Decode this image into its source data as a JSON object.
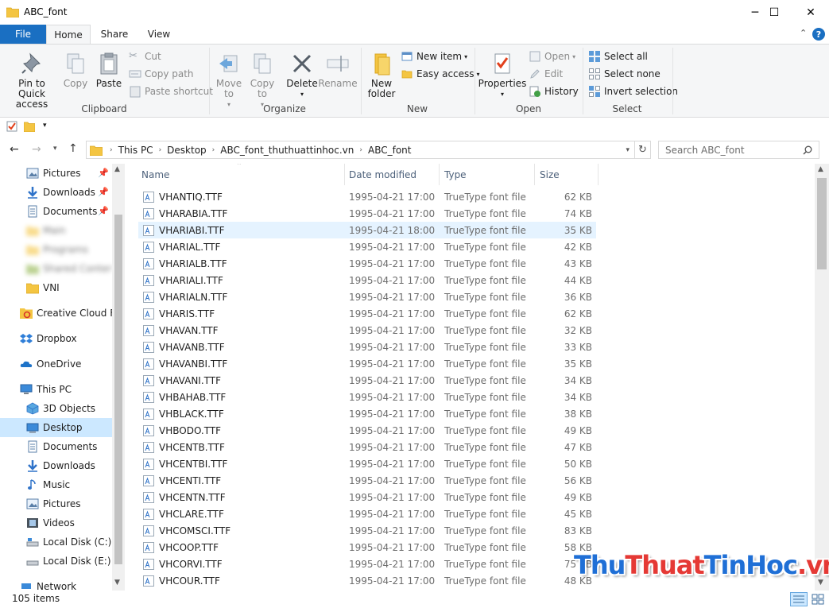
{
  "window": {
    "title": "ABC_font",
    "minimize_glyph": "─",
    "maximize_glyph": "☐",
    "close_glyph": "✕"
  },
  "ribbon_tabs": {
    "file": "File",
    "home": "Home",
    "share": "Share",
    "view": "View",
    "collapse_glyph": "⌃",
    "help_glyph": "?"
  },
  "ribbon": {
    "clipboard": {
      "label": "Clipboard",
      "pin": "Pin to Quick access",
      "copy": "Copy",
      "paste": "Paste",
      "cut": "Cut",
      "copy_path": "Copy path",
      "paste_shortcut": "Paste shortcut"
    },
    "organize": {
      "label": "Organize",
      "move_to": "Move to",
      "copy_to": "Copy to",
      "delete": "Delete",
      "rename": "Rename"
    },
    "new": {
      "label": "New",
      "new_folder": "New folder",
      "new_item": "New item",
      "easy_access": "Easy access"
    },
    "open": {
      "label": "Open",
      "properties": "Properties",
      "open": "Open",
      "edit": "Edit",
      "history": "History"
    },
    "select": {
      "label": "Select",
      "select_all": "Select all",
      "select_none": "Select none",
      "invert_selection": "Invert selection"
    }
  },
  "address": {
    "breadcrumbs": [
      "This PC",
      "Desktop",
      "ABC_font_thuthuattinhoc.vn",
      "ABC_font"
    ],
    "search_placeholder": "Search ABC_font"
  },
  "nav_pane": {
    "quick_access": [
      {
        "label": "Pictures",
        "icon": "pictures-icon",
        "pinned": true
      },
      {
        "label": "Downloads",
        "icon": "downloads-icon",
        "pinned": true
      },
      {
        "label": "Documents",
        "icon": "documents-icon",
        "pinned": true
      }
    ],
    "blurred_items": [
      "Main",
      "Programs",
      "Shared Content"
    ],
    "vni": "VNI",
    "creative_cloud": "Creative Cloud Fil",
    "dropbox": "Dropbox",
    "onedrive": "OneDrive",
    "this_pc": "This PC",
    "this_pc_items": [
      {
        "label": "3D Objects",
        "icon": "3d-objects-icon",
        "selected": false
      },
      {
        "label": "Desktop",
        "icon": "desktop-icon",
        "selected": true
      },
      {
        "label": "Documents",
        "icon": "documents-icon",
        "selected": false
      },
      {
        "label": "Downloads",
        "icon": "downloads-icon",
        "selected": false
      },
      {
        "label": "Music",
        "icon": "music-icon",
        "selected": false
      },
      {
        "label": "Pictures",
        "icon": "pictures-icon",
        "selected": false
      },
      {
        "label": "Videos",
        "icon": "videos-icon",
        "selected": false
      },
      {
        "label": "Local Disk (C:)",
        "icon": "drive-icon",
        "selected": false
      },
      {
        "label": "Local Disk (E:)",
        "icon": "drive-icon",
        "selected": false
      }
    ],
    "network": "Network"
  },
  "file_list": {
    "columns": {
      "name": "Name",
      "date": "Date modified",
      "type": "Type",
      "size": "Size"
    },
    "hovered_row": 2,
    "rows": [
      {
        "name": "VHANTIQ.TTF",
        "date": "1995-04-21 17:00",
        "type": "TrueType font file",
        "size": "62 KB"
      },
      {
        "name": "VHARABIA.TTF",
        "date": "1995-04-21 17:00",
        "type": "TrueType font file",
        "size": "74 KB"
      },
      {
        "name": "VHARIABI.TTF",
        "date": "1995-04-21 18:00",
        "type": "TrueType font file",
        "size": "35 KB"
      },
      {
        "name": "VHARIAL.TTF",
        "date": "1995-04-21 17:00",
        "type": "TrueType font file",
        "size": "42 KB"
      },
      {
        "name": "VHARIALB.TTF",
        "date": "1995-04-21 17:00",
        "type": "TrueType font file",
        "size": "43 KB"
      },
      {
        "name": "VHARIALI.TTF",
        "date": "1995-04-21 17:00",
        "type": "TrueType font file",
        "size": "44 KB"
      },
      {
        "name": "VHARIALN.TTF",
        "date": "1995-04-21 17:00",
        "type": "TrueType font file",
        "size": "36 KB"
      },
      {
        "name": "VHARIS.TTF",
        "date": "1995-04-21 17:00",
        "type": "TrueType font file",
        "size": "62 KB"
      },
      {
        "name": "VHAVAN.TTF",
        "date": "1995-04-21 17:00",
        "type": "TrueType font file",
        "size": "32 KB"
      },
      {
        "name": "VHAVANB.TTF",
        "date": "1995-04-21 17:00",
        "type": "TrueType font file",
        "size": "33 KB"
      },
      {
        "name": "VHAVANBI.TTF",
        "date": "1995-04-21 17:00",
        "type": "TrueType font file",
        "size": "35 KB"
      },
      {
        "name": "VHAVANI.TTF",
        "date": "1995-04-21 17:00",
        "type": "TrueType font file",
        "size": "34 KB"
      },
      {
        "name": "VHBAHAB.TTF",
        "date": "1995-04-21 17:00",
        "type": "TrueType font file",
        "size": "34 KB"
      },
      {
        "name": "VHBLACK.TTF",
        "date": "1995-04-21 17:00",
        "type": "TrueType font file",
        "size": "38 KB"
      },
      {
        "name": "VHBODO.TTF",
        "date": "1995-04-21 17:00",
        "type": "TrueType font file",
        "size": "49 KB"
      },
      {
        "name": "VHCENTB.TTF",
        "date": "1995-04-21 17:00",
        "type": "TrueType font file",
        "size": "47 KB"
      },
      {
        "name": "VHCENTBI.TTF",
        "date": "1995-04-21 17:00",
        "type": "TrueType font file",
        "size": "50 KB"
      },
      {
        "name": "VHCENTI.TTF",
        "date": "1995-04-21 17:00",
        "type": "TrueType font file",
        "size": "56 KB"
      },
      {
        "name": "VHCENTN.TTF",
        "date": "1995-04-21 17:00",
        "type": "TrueType font file",
        "size": "49 KB"
      },
      {
        "name": "VHCLARE.TTF",
        "date": "1995-04-21 17:00",
        "type": "TrueType font file",
        "size": "45 KB"
      },
      {
        "name": "VHCOMSCI.TTF",
        "date": "1995-04-21 17:00",
        "type": "TrueType font file",
        "size": "83 KB"
      },
      {
        "name": "VHCOOP.TTF",
        "date": "1995-04-21 17:00",
        "type": "TrueType font file",
        "size": "58 KB"
      },
      {
        "name": "VHCORVI.TTF",
        "date": "1995-04-21 17:00",
        "type": "TrueType font file",
        "size": "75 KB"
      },
      {
        "name": "VHCOUR.TTF",
        "date": "1995-04-21 17:00",
        "type": "TrueType font file",
        "size": "48 KB"
      }
    ]
  },
  "status": {
    "item_count": "105 items"
  },
  "watermark": {
    "part1": "Thu",
    "part2": "Thuat",
    "part3": "TinHoc",
    "part4": ".vn",
    "color1": "#1f6fd6",
    "color2": "#e53935",
    "color3": "#1f6fd6",
    "color4": "#e53935"
  },
  "colors": {
    "accent": "#1a6fc2",
    "selection": "#cce8ff",
    "hover": "#e5f3ff"
  }
}
